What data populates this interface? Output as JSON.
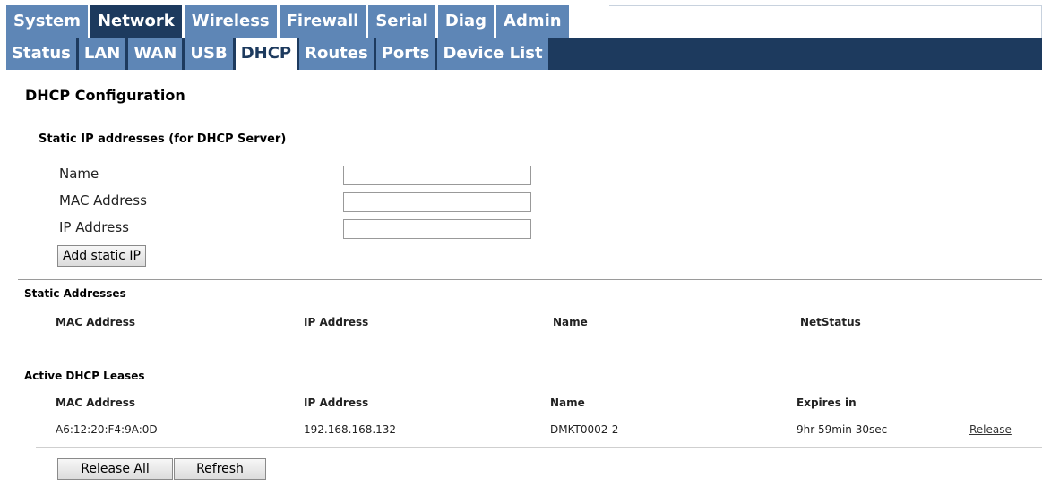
{
  "nav": {
    "main_tabs": [
      "System",
      "Network",
      "Wireless",
      "Firewall",
      "Serial",
      "Diag",
      "Admin"
    ],
    "active_main": "Network",
    "sub_tabs": [
      "Status",
      "LAN",
      "WAN",
      "USB",
      "DHCP",
      "Routes",
      "Ports",
      "Device List"
    ],
    "active_sub": "DHCP"
  },
  "page": {
    "title": "DHCP Configuration",
    "static_section_title": "Static IP addresses (for DHCP Server)"
  },
  "form": {
    "name_label": "Name",
    "mac_label": "MAC Address",
    "ip_label": "IP Address",
    "name_value": "",
    "mac_value": "",
    "ip_value": "",
    "add_button": "Add static IP"
  },
  "static_addresses": {
    "title": "Static Addresses",
    "columns": [
      "MAC Address",
      "IP Address",
      "Name",
      "NetStatus"
    ]
  },
  "leases": {
    "title": "Active DHCP Leases",
    "columns": [
      "MAC Address",
      "IP Address",
      "Name",
      "Expires in"
    ],
    "rows": [
      {
        "mac": "A6:12:20:F4:9A:0D",
        "ip": "192.168.168.132",
        "name": "DMKT0002-2",
        "expires": "9hr 59min 30sec",
        "action": "Release"
      }
    ],
    "release_all_button": "Release All",
    "refresh_button": "Refresh"
  },
  "colors": {
    "tab_light": "#5e86b6",
    "tab_dark": "#1d3a5e"
  }
}
